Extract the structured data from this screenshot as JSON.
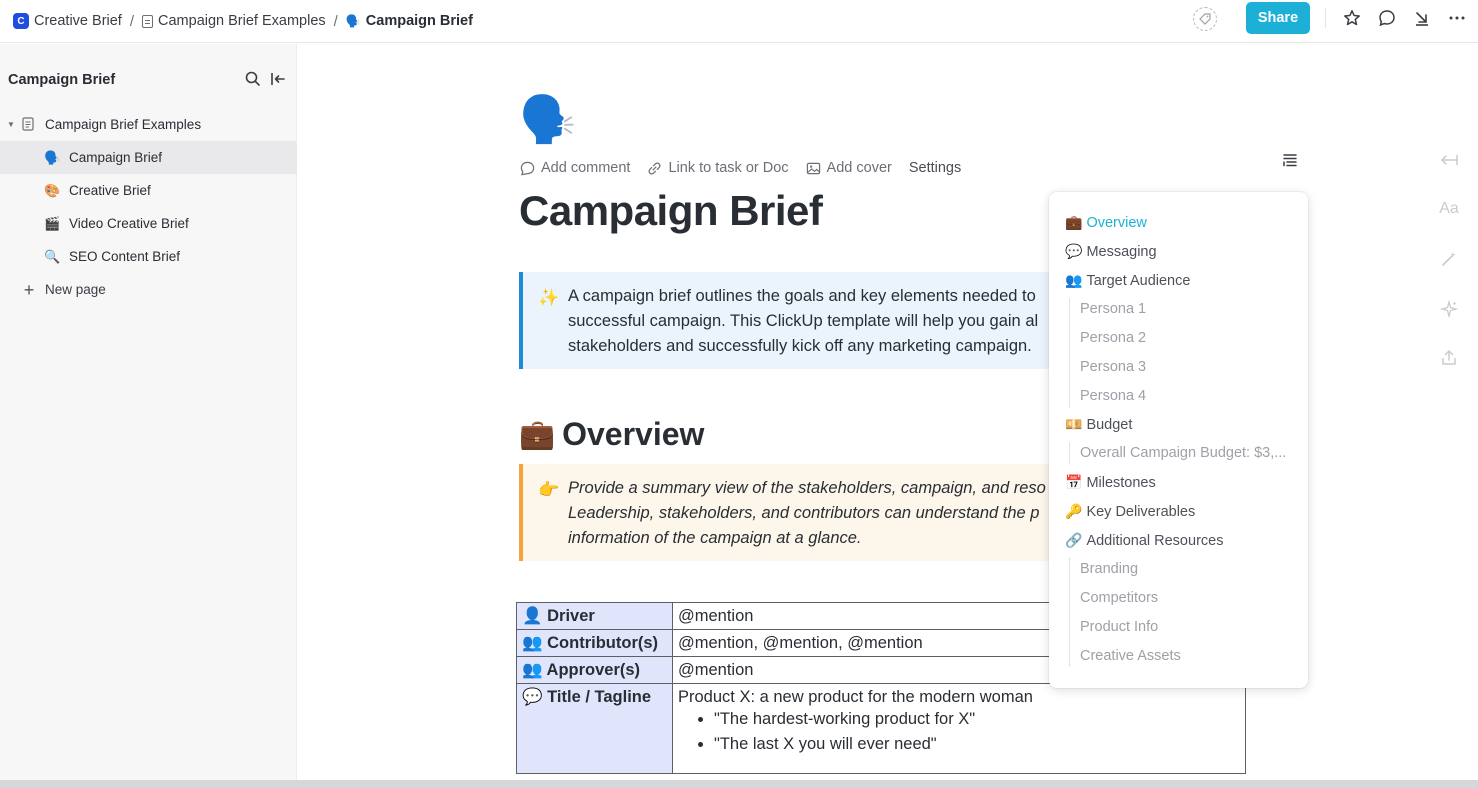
{
  "breadcrumb": {
    "space": "Creative Brief",
    "space_logo": "C",
    "folder": "Campaign Brief Examples",
    "current": "Campaign Brief",
    "separator": "/"
  },
  "topbar": {
    "share_label": "Share",
    "icons": [
      "tag-icon",
      "star-icon",
      "comment-icon",
      "download-icon",
      "more-icon"
    ],
    "accent_color": "#1db0d6"
  },
  "sidebar": {
    "title": "Campaign Brief",
    "parent": "Campaign Brief Examples",
    "items": [
      {
        "label": "Campaign Brief",
        "emoji": "🗣️",
        "active": true
      },
      {
        "label": "Creative Brief",
        "emoji": "🎨",
        "active": false
      },
      {
        "label": "Video Creative Brief",
        "emoji": "🎬",
        "active": false
      },
      {
        "label": "SEO Content Brief",
        "emoji": "🔍",
        "active": false
      }
    ],
    "new_page": "New page"
  },
  "doc": {
    "emoji": "🗣️",
    "actions": {
      "add_comment": "Add comment",
      "link": "Link to task or Doc",
      "add_cover": "Add cover",
      "settings": "Settings"
    },
    "title": "Campaign Brief",
    "intro_callout": {
      "emoji": "✨",
      "lines": [
        "A campaign brief outlines the goals and key elements needed to",
        "successful campaign. This ClickUp template will help you gain al",
        "stakeholders and successfully kick off any marketing campaign."
      ]
    },
    "overview_heading": {
      "emoji": "💼",
      "text": "Overview"
    },
    "overview_callout": {
      "emoji": "👉",
      "lines": [
        "Provide a summary view of the stakeholders, campaign, and reso",
        "Leadership, stakeholders, and contributors can understand the p",
        "information of the campaign at a glance."
      ]
    },
    "table": [
      {
        "emoji": "👤",
        "key": "Driver",
        "value": "@mention"
      },
      {
        "emoji": "👥",
        "key": "Contributor(s)",
        "value": "@mention, @mention, @mention"
      },
      {
        "emoji": "👥",
        "key": "Approver(s)",
        "value": "@mention"
      },
      {
        "emoji": "💬",
        "key": "Title / Tagline",
        "value": "Product X: a new product for the modern woman",
        "bullets": [
          "\"The hardest-working product for X\"",
          "\"The last X you will ever need\""
        ]
      }
    ]
  },
  "toc": {
    "items": [
      {
        "emoji": "💼",
        "label": "Overview",
        "level": 1,
        "active": true
      },
      {
        "emoji": "💬",
        "label": "Messaging",
        "level": 1
      },
      {
        "emoji": "👥",
        "label": "Target Audience",
        "level": 1
      },
      {
        "label": "Persona 1",
        "level": 2
      },
      {
        "label": "Persona 2",
        "level": 2
      },
      {
        "label": "Persona 3",
        "level": 2
      },
      {
        "label": "Persona 4",
        "level": 2
      },
      {
        "emoji": "💴",
        "label": "Budget",
        "level": 1
      },
      {
        "label": "Overall Campaign Budget: $3,...",
        "level": 2
      },
      {
        "emoji": "📅",
        "label": "Milestones",
        "level": 1
      },
      {
        "emoji": "🔑",
        "label": "Key Deliverables",
        "level": 1
      },
      {
        "emoji": "🔗",
        "label": "Additional Resources",
        "level": 1
      },
      {
        "label": "Branding",
        "level": 2
      },
      {
        "label": "Competitors",
        "level": 2
      },
      {
        "label": "Product Info",
        "level": 2
      },
      {
        "label": "Creative Assets",
        "level": 2
      }
    ]
  },
  "right_rail": {
    "icons": [
      "collapse-width-icon",
      "font-size-icon",
      "ai-wand-icon",
      "ai-sparkle-icon",
      "share-export-icon"
    ],
    "font_label": "Aa"
  }
}
